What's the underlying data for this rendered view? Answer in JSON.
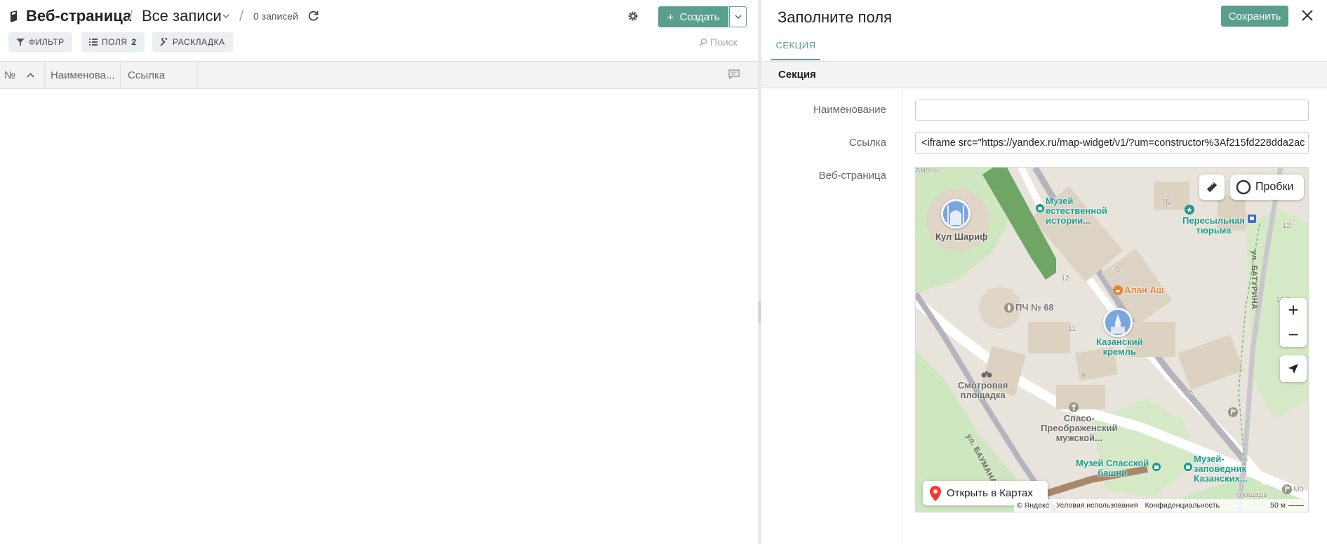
{
  "header": {
    "title": "Веб-страница",
    "view_name": "Все записи",
    "record_count": "0 записей",
    "create_label": "Создать"
  },
  "toolbar": {
    "filter_label": "ФИЛЬТР",
    "fields_label": "ПОЛЯ",
    "fields_count": "2",
    "layout_label": "РАСКЛАДКА",
    "search_placeholder": "Поиск"
  },
  "table": {
    "columns": [
      "№",
      "Наименова...",
      "Ссылка"
    ]
  },
  "form": {
    "title": "Заполните поля",
    "save_label": "Сохранить",
    "tab_label": "СЕКЦИЯ",
    "section_title": "Секция",
    "fields": {
      "name_label": "Наименование",
      "name_value": "",
      "link_label": "Ссылка",
      "link_value": "<iframe src=\"https://yandex.ru/map-widget/v1/?um=constructor%3Af215fd228dda2ac",
      "webpage_label": "Веб-страница"
    }
  },
  "map": {
    "traffic_label": "Пробки",
    "open_in_maps": "Открыть в Картах",
    "footer": [
      "© Яндекс",
      "Условия использования",
      "Конфиденциальность",
      "50 м"
    ],
    "places": {
      "kul_sharif": "Кул Шариф",
      "museum_nat_hist": [
        "Музей",
        "естественной",
        "истории..."
      ],
      "prison": [
        "Пересыльная",
        "тюрьма"
      ],
      "alan_ash": "Алан Аш",
      "pch68": "ПЧ № 68",
      "kremlin": [
        "Казанский",
        "кремль"
      ],
      "observation": [
        "Смотровая",
        "площадка"
      ],
      "monastery": [
        "Спасо-",
        "Преображенский",
        "мужской..."
      ],
      "spasskaya": [
        "Музей Спасской",
        "башни"
      ],
      "museum_reserve": [
        "Музей-",
        "заповедник",
        "Казанских..."
      ],
      "street_baturina": "ул. БАТУРИНА",
      "street_baumana": "ул. БАУМАНА",
      "kamen": "амень",
      "ploshad": "площадь",
      "me": "Мэ",
      "nums": [
        "7Б",
        "12",
        "5",
        "10/1",
        "11",
        "9",
        "6",
        "12"
      ]
    }
  },
  "colors": {
    "accent": "#5a9e8e",
    "teal_poi": "#1a9a8a",
    "orange_poi": "#e8843a"
  }
}
